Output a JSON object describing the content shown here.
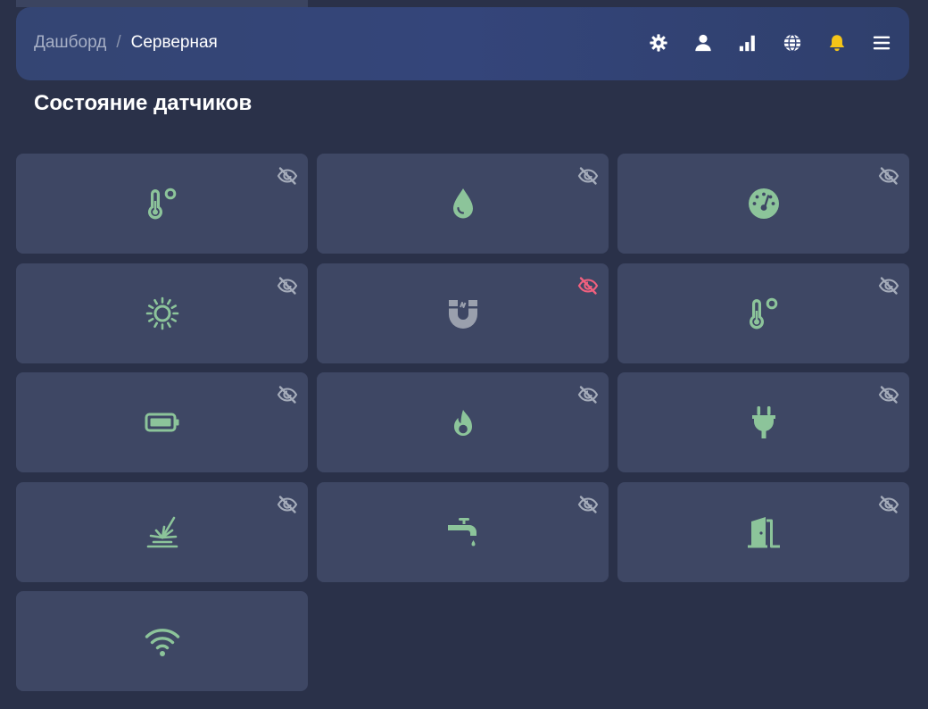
{
  "breadcrumb": {
    "root": "Дашборд",
    "separator": "/",
    "current": "Серверная"
  },
  "header_icons": [
    {
      "name": "gear-icon",
      "color": "#ffffff"
    },
    {
      "name": "user-icon",
      "color": "#ffffff"
    },
    {
      "name": "signal-bars-icon",
      "color": "#ffffff"
    },
    {
      "name": "globe-icon",
      "color": "#ffffff"
    },
    {
      "name": "bell-icon",
      "color": "#f5c518"
    },
    {
      "name": "menu-icon",
      "color": "#ffffff"
    }
  ],
  "section_title": "Состояние датчиков",
  "colors": {
    "active_icon": "#8cc49a",
    "inactive_icon": "#9aa0ad",
    "hidden_normal": "#a5acba",
    "hidden_alert": "#f0607e",
    "tile_bg": "#3e4764",
    "page_bg": "#2a3149"
  },
  "sensors": [
    {
      "icon": "thermometer-icon",
      "state": "active",
      "visibility_icon": "eye-slash-icon",
      "visibility_state": "normal"
    },
    {
      "icon": "water-drop-icon",
      "state": "active",
      "visibility_icon": "eye-slash-icon",
      "visibility_state": "normal"
    },
    {
      "icon": "gauge-icon",
      "state": "active",
      "visibility_icon": "eye-slash-icon",
      "visibility_state": "normal"
    },
    {
      "icon": "sun-icon",
      "state": "active",
      "visibility_icon": "eye-slash-icon",
      "visibility_state": "normal"
    },
    {
      "icon": "magnet-icon",
      "state": "inactive",
      "visibility_icon": "eye-slash-icon",
      "visibility_state": "alert"
    },
    {
      "icon": "thermometer-icon",
      "state": "active",
      "visibility_icon": "eye-slash-icon",
      "visibility_state": "normal"
    },
    {
      "icon": "battery-icon",
      "state": "active",
      "visibility_icon": "eye-slash-icon",
      "visibility_state": "normal"
    },
    {
      "icon": "fire-icon",
      "state": "active",
      "visibility_icon": "eye-slash-icon",
      "visibility_state": "normal"
    },
    {
      "icon": "plug-icon",
      "state": "active",
      "visibility_icon": "eye-slash-icon",
      "visibility_state": "normal"
    },
    {
      "icon": "motion-burst-icon",
      "state": "active",
      "visibility_icon": "eye-slash-icon",
      "visibility_state": "normal"
    },
    {
      "icon": "faucet-icon",
      "state": "active",
      "visibility_icon": "eye-slash-icon",
      "visibility_state": "normal"
    },
    {
      "icon": "door-icon",
      "state": "active",
      "visibility_icon": "eye-slash-icon",
      "visibility_state": "normal"
    },
    {
      "icon": "wifi-icon",
      "state": "active",
      "visibility_icon": null,
      "visibility_state": null
    }
  ]
}
